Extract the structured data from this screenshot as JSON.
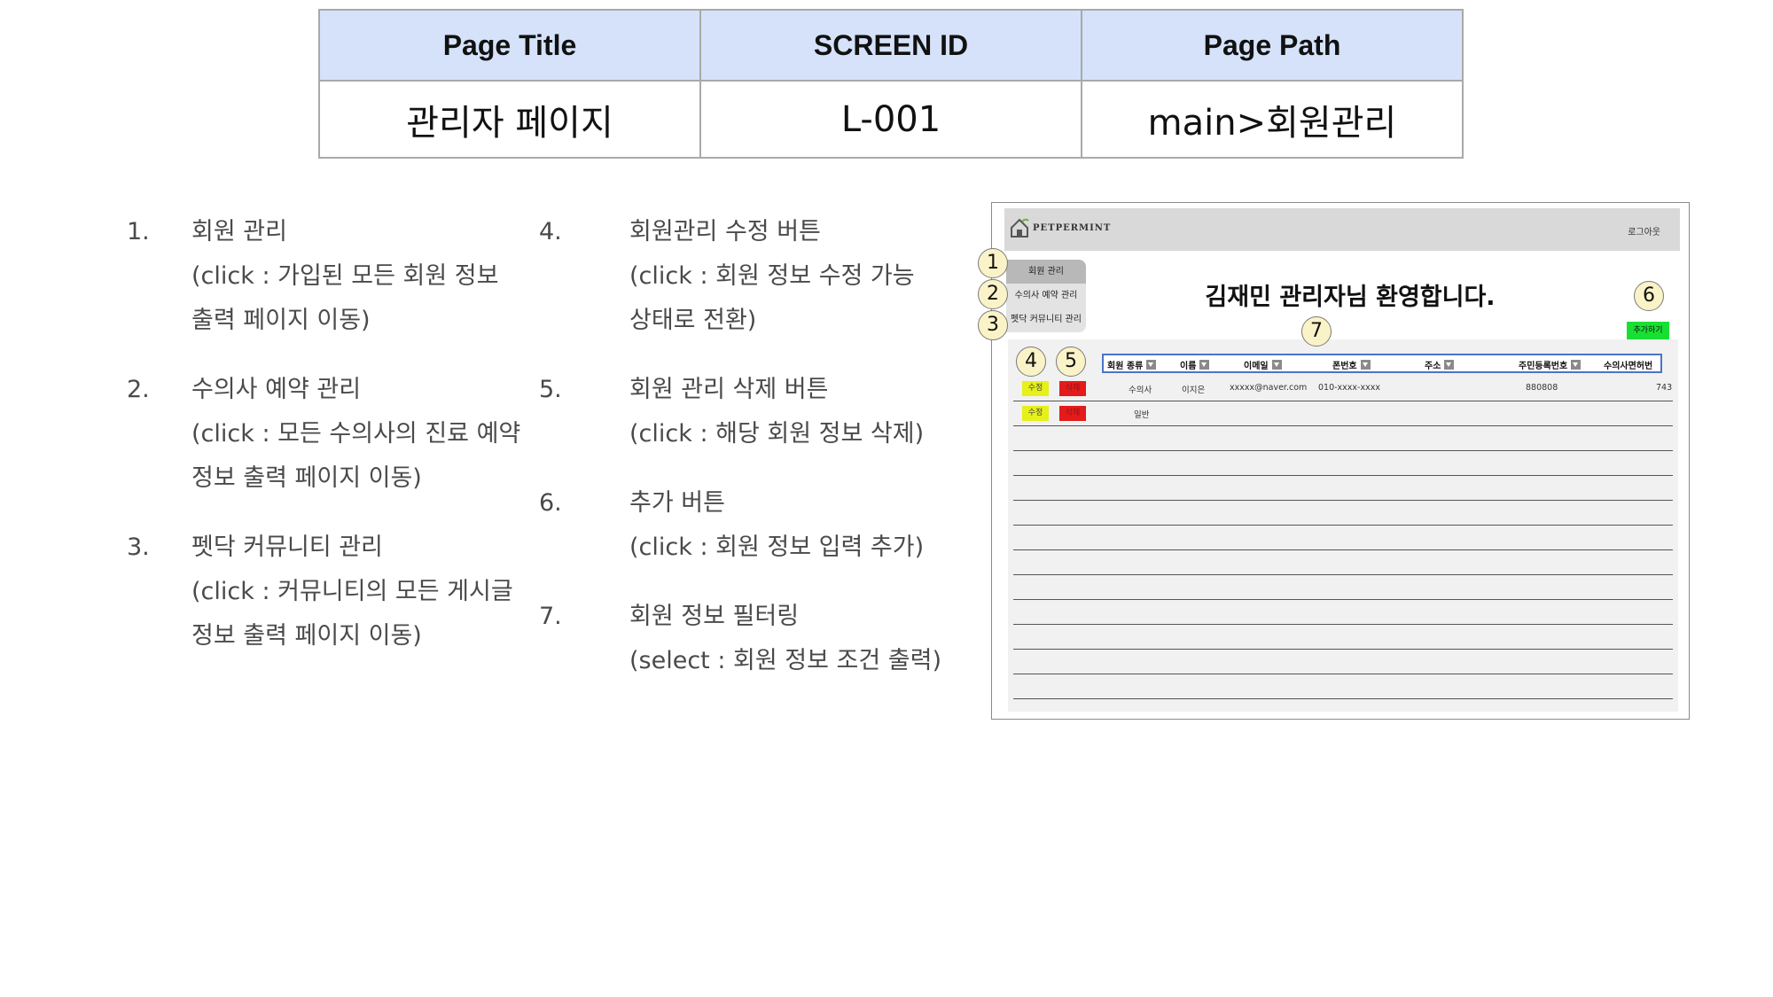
{
  "header_table": {
    "headers": [
      "Page Title",
      "SCREEN ID",
      "Page Path"
    ],
    "values": [
      "관리자 페이지",
      "L-001",
      "main>회원관리"
    ]
  },
  "descriptions": [
    {
      "num": "1.",
      "lines": [
        "회원 관리",
        "(click : 가입된 모든 회원 정보",
        "출력 페이지 이동)"
      ]
    },
    {
      "num": "2.",
      "lines": [
        "수의사 예약 관리",
        "(click : 모든 수의사의 진료 예약",
        "정보 출력 페이지 이동)"
      ]
    },
    {
      "num": "3.",
      "lines": [
        "펫닥 커뮤니티 관리",
        "(click : 커뮤니티의 모든 게시글",
        "정보 출력 페이지 이동)"
      ]
    },
    {
      "num": "4.",
      "lines": [
        "회원관리 수정 버튼",
        "(click : 회원 정보 수정 가능",
        "상태로 전환)"
      ]
    },
    {
      "num": "5.",
      "lines": [
        "회원 관리 삭제 버튼",
        "(click : 해당 회원 정보 삭제)"
      ]
    },
    {
      "num": "6.",
      "lines": [
        "추가 버튼",
        "(click : 회원 정보 입력 추가)"
      ]
    },
    {
      "num": "7.",
      "lines": [
        "회원 정보 필터링",
        "(select : 회원 정보 조건 출력)"
      ]
    }
  ],
  "mockup": {
    "brand": "PETPERMINT",
    "logout": "로그아웃",
    "menu": [
      "회원 관리",
      "수의사 예약 관리",
      "펫닥 커뮤니티 관리"
    ],
    "welcome": "김재민 관리자님 환영합니다.",
    "add_button": "추가하기",
    "filter_columns": [
      "회원 종류",
      "이름",
      "이메일",
      "폰번호",
      "주소",
      "주민등록번호",
      "수의사면허번"
    ],
    "edit_label": "수정",
    "delete_label": "삭제",
    "rows": [
      {
        "type": "수의사",
        "name": "이지은",
        "email": "xxxxx@naver.com",
        "phone": "010-xxxx-xxxx",
        "rrn": "880808",
        "license": "743"
      },
      {
        "type": "일반",
        "name": "",
        "email": "",
        "phone": "",
        "rrn": "",
        "license": ""
      }
    ],
    "badges": [
      "1",
      "2",
      "3",
      "4",
      "5",
      "6",
      "7"
    ]
  }
}
